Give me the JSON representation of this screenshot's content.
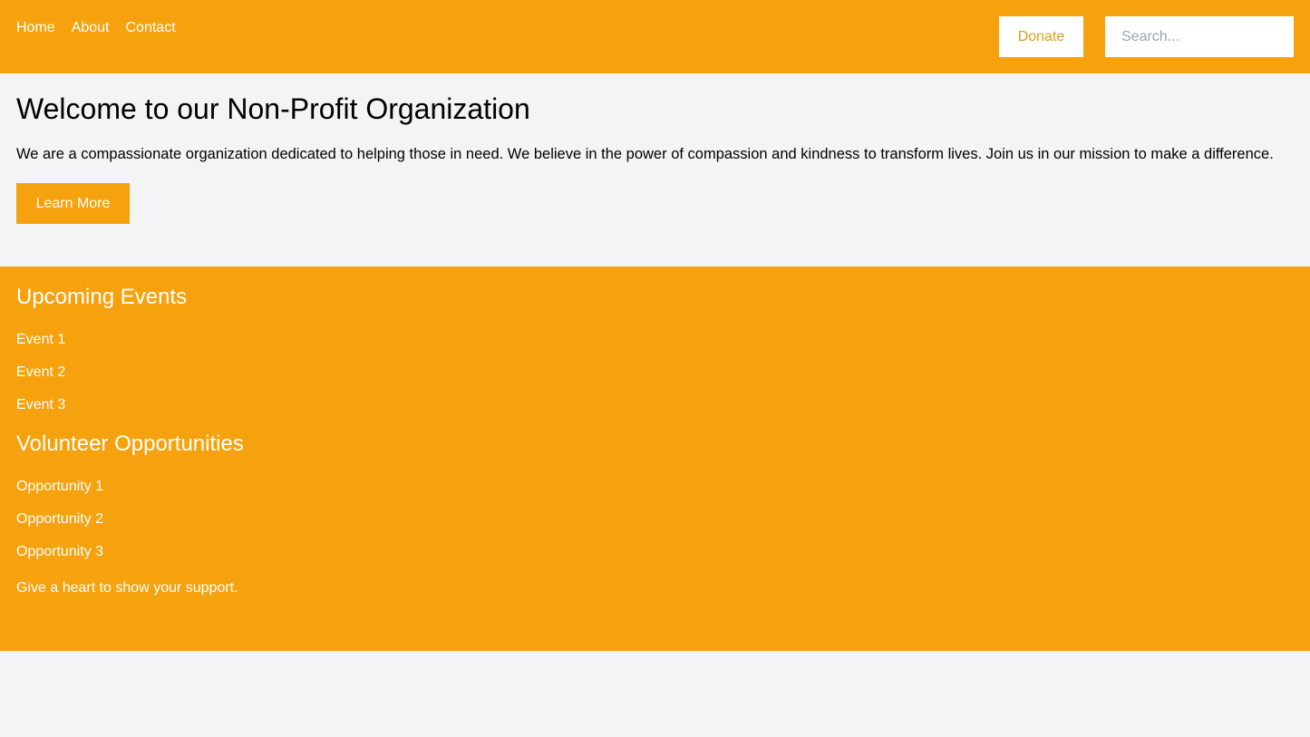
{
  "colors": {
    "accent": "#f5a20e",
    "background": "#f3f4f6",
    "donate_text": "#dd9b18"
  },
  "header": {
    "nav": [
      {
        "label": "Home"
      },
      {
        "label": "About"
      },
      {
        "label": "Contact"
      }
    ],
    "donate_label": "Donate",
    "search": {
      "placeholder": "Search...",
      "value": ""
    }
  },
  "intro": {
    "title": "Welcome to our Non-Profit Organization",
    "description": "We are a compassionate organization dedicated to helping those in need. We believe in the power of compassion and kindness to transform lives. Join us in our mission to make a difference.",
    "button_label": "Learn More"
  },
  "events": {
    "title": "Upcoming Events",
    "items": [
      {
        "label": "Event 1"
      },
      {
        "label": "Event 2"
      },
      {
        "label": "Event 3"
      }
    ]
  },
  "volunteer": {
    "title": "Volunteer Opportunities",
    "items": [
      {
        "label": "Opportunity 1"
      },
      {
        "label": "Opportunity 2"
      },
      {
        "label": "Opportunity 3"
      }
    ]
  },
  "support_text": "Give a heart to show your support."
}
